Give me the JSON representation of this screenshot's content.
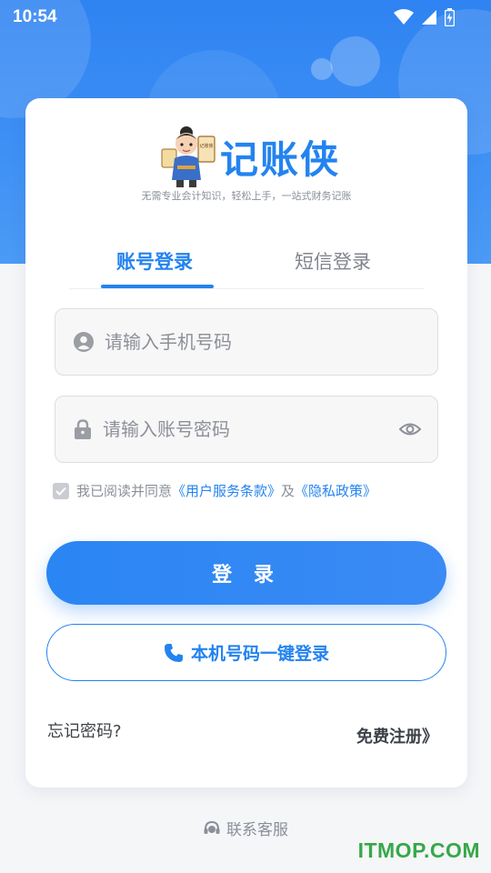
{
  "status_bar": {
    "time": "10:54"
  },
  "app": {
    "name": "记账侠",
    "tagline": "无需专业会计知识，轻松上手，一站式财务记账",
    "mascot_sign_text": "记账侠"
  },
  "tabs": [
    {
      "label": "账号登录",
      "active": true
    },
    {
      "label": "短信登录",
      "active": false
    }
  ],
  "form": {
    "phone_placeholder": "请输入手机号码",
    "password_placeholder": "请输入账号密码",
    "phone_value": "",
    "password_value": ""
  },
  "agreement": {
    "checked": true,
    "prefix": "我已阅读并同意",
    "terms_link": "《用户服务条款》",
    "conjunction": "及",
    "privacy_link": "《隐私政策》"
  },
  "buttons": {
    "login": "登 录",
    "one_key": "本机号码一键登录"
  },
  "links": {
    "forgot": "忘记密码?",
    "register": "免费注册》"
  },
  "footer": {
    "service": "联系客服",
    "watermark": "ITMOP.COM"
  },
  "colors": {
    "accent": "#2383f0",
    "header_bg": "#2f83f2",
    "watermark": "#36a84a"
  }
}
